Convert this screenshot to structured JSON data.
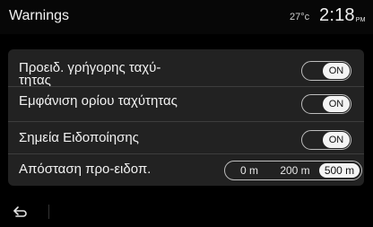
{
  "header": {
    "title": "Warnings",
    "temperature": "27°c",
    "time": "2:18",
    "ampm": "PM"
  },
  "settings": [
    {
      "label": "Προειδ. γρήγορης ταχύ-\nτητας",
      "control": "toggle",
      "value": "ON"
    },
    {
      "label": "Εμφάνιση ορίου ταχύτητας",
      "control": "toggle",
      "value": "ON"
    },
    {
      "label": "Σημεία Ειδοποίησης",
      "control": "toggle",
      "value": "ON"
    },
    {
      "label": "Απόσταση προ-ειδοπ.",
      "control": "segmented",
      "options": [
        "0 m",
        "200 m",
        "500 m"
      ],
      "selected": "500 m"
    }
  ],
  "footer": {
    "back_icon": "back-arrow-icon"
  }
}
